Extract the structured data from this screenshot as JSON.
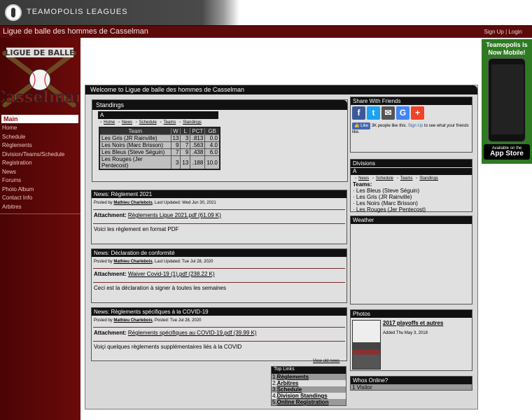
{
  "header": {
    "brand": "Teamopolis Leagues"
  },
  "titlebar": {
    "title": "Ligue de balle des hommes de Casselman",
    "signup": "Sign Up",
    "sep": "|",
    "login": "Login"
  },
  "sidebar": {
    "logo_text_top": "LIGUE DE BALLE",
    "logo_text_main": "Casselman",
    "menu_head": "Main",
    "items": [
      {
        "label": "Home"
      },
      {
        "label": "Schedule"
      },
      {
        "label": "Règlements"
      },
      {
        "label": "Division/Teams/Schedule"
      },
      {
        "label": "Registration"
      },
      {
        "label": "News"
      },
      {
        "label": "Forums"
      },
      {
        "label": "Photo Album"
      },
      {
        "label": "Contact Info"
      },
      {
        "label": "Arbitres"
      }
    ]
  },
  "ad": {
    "line1": "Teamopolis Is",
    "line2": "Now Mobile!",
    "store_small": "Available on the",
    "store_big": "App Store"
  },
  "main": {
    "welcome": "Welcome to Ligue de balle des hommes de Casselman"
  },
  "standings": {
    "title": "Standings",
    "division": "A",
    "links": [
      "Home",
      "News",
      "Schedule",
      "Teams",
      "Standings"
    ],
    "columns": [
      "Team",
      "W",
      "L",
      "PCT",
      "GB"
    ],
    "rows": [
      {
        "team": "Les Gris (JR Rainville)",
        "w": "13",
        "l": "3",
        "pct": ".813",
        "gb": "0.0"
      },
      {
        "team": "Les Noirs (Marc Brisson)",
        "w": "9",
        "l": "7",
        "pct": ".563",
        "gb": "4.0"
      },
      {
        "team": "Les Bleus (Steve Séguin)",
        "w": "7",
        "l": "9",
        "pct": ".438",
        "gb": "6.0"
      },
      {
        "team": "Les Rouges (Jer Pentecost)",
        "w": "3",
        "l": "13",
        "pct": ".188",
        "gb": "10.0"
      }
    ]
  },
  "news": [
    {
      "title": "News: Règlement 2021",
      "posted_by": "Posted by",
      "author": "Mathieu Charlebois",
      "date": ", Last Updated: Wed Jun 30, 2021",
      "attach_label": "Attachment:",
      "attach_file": "Règlements Ligue 2021.pdf (61.09 K)",
      "body": "Voici les règlement en format PDF"
    },
    {
      "title": "News: Déclaration de conformité",
      "posted_by": "Posted by",
      "author": "Mathieu Charlebois",
      "date": ", Last Updated: Tue Jul 28, 2020",
      "attach_label": "Attachment:",
      "attach_file": "Waiver Covid-19 (1).pdf (238.22 K)",
      "body": "Ceci est la déclaration à signer à toutes les semaines"
    },
    {
      "title": "News: Règlements spécifiques à la COVID-19",
      "posted_by": "Posted by",
      "author": "Mathieu Charlebois",
      "date": ", Posted: Tue Jul 28, 2020",
      "attach_label": "Attachment:",
      "attach_file": "Règlements spécifiques au COVID-19.pdf (39.99 K)",
      "body": "Voiçi quelques règlements supplémentaires liés à la COVID"
    }
  ],
  "view_old": "View old news",
  "top_links": {
    "title": "Top Links",
    "items": [
      {
        "num": "1.",
        "label": "Règlements"
      },
      {
        "num": "2.",
        "label": "Arbitres"
      },
      {
        "num": "3.",
        "label": "Schedule"
      },
      {
        "num": "4.",
        "label": "Division Standings"
      },
      {
        "num": "5.",
        "label": "Online Registration"
      }
    ]
  },
  "share": {
    "title": "Share With Friends",
    "like_btn": "Like",
    "like_text_a": "3K people like this.",
    "like_signup": "Sign Up",
    "like_text_b": "to see what your friends like."
  },
  "divisions": {
    "title": "Divisions",
    "division": "A",
    "links": [
      "News",
      "Schedule",
      "Teams",
      "Standings"
    ],
    "teams_label": "Teams:",
    "teams": [
      "Les Bleus (Steve Séguin)",
      "Les Gris (JR Rainville)",
      "Les Noirs (Marc Brisson)",
      "Les Rouges (Jer Pentecost)"
    ]
  },
  "weather": {
    "title": "Weather"
  },
  "photos": {
    "title": "Photos",
    "album": "2017 playoffs et autres",
    "added": "Added Thu May 3, 2018"
  },
  "online": {
    "title": "Whos Online?",
    "count": "1 Visitor"
  },
  "colors": {
    "maroon": "#5c0a0a",
    "panel": "#d9d9d9",
    "header": "#111111"
  }
}
